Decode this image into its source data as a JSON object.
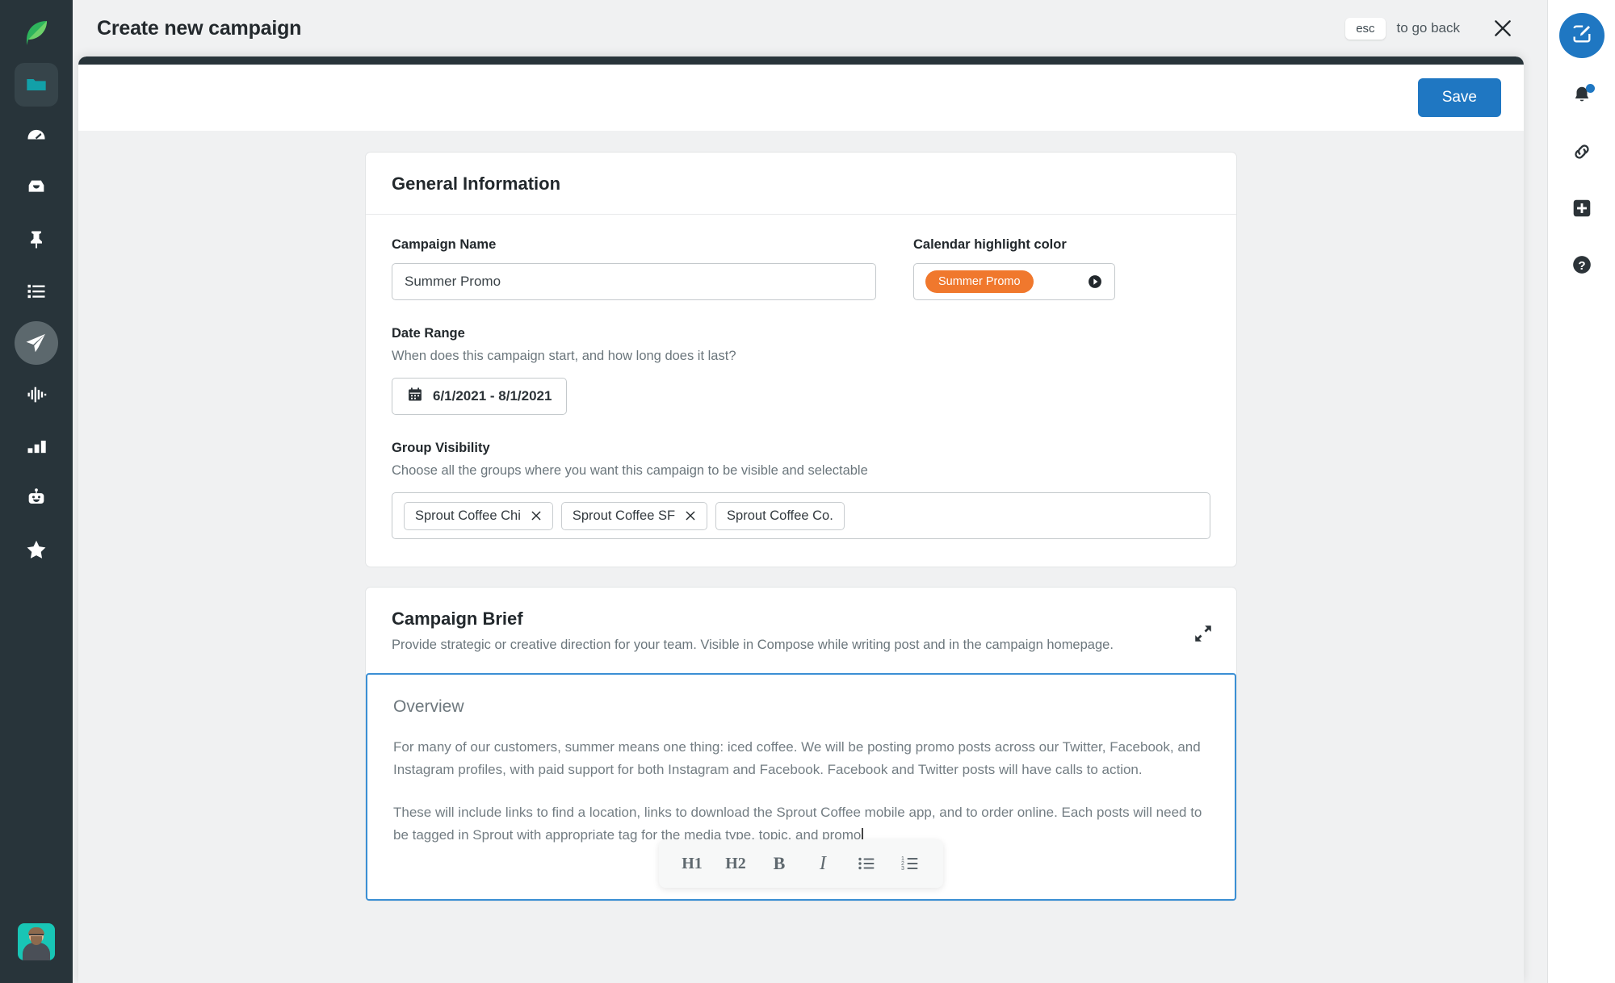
{
  "header": {
    "title": "Create new campaign",
    "esc_key": "esc",
    "esc_hint": "to go back",
    "close_icon": "close-icon"
  },
  "left_nav": {
    "logo_icon": "sprout-leaf-logo",
    "items": [
      {
        "icon": "folder-icon",
        "name": "folder",
        "state": "boxed"
      },
      {
        "icon": "dashboard-speedometer-icon",
        "name": "dashboard",
        "state": ""
      },
      {
        "icon": "inbox-icon",
        "name": "inbox",
        "state": ""
      },
      {
        "icon": "pin-icon",
        "name": "publishing-pin",
        "state": ""
      },
      {
        "icon": "list-icon",
        "name": "tasks-list",
        "state": ""
      },
      {
        "icon": "paper-plane-icon",
        "name": "publishing",
        "state": "active"
      },
      {
        "icon": "pulse-waveform-icon",
        "name": "listening",
        "state": ""
      },
      {
        "icon": "bar-chart-icon",
        "name": "reports",
        "state": ""
      },
      {
        "icon": "bot-icon",
        "name": "bots",
        "state": ""
      },
      {
        "icon": "star-half-icon",
        "name": "reviews",
        "state": ""
      }
    ],
    "avatar_name": "user-avatar"
  },
  "right_rail": {
    "compose_icon": "compose-pencil-icon",
    "items": [
      {
        "icon": "bell-icon",
        "name": "notifications",
        "badge": true
      },
      {
        "icon": "link-icon",
        "name": "link-shortener",
        "badge": false
      },
      {
        "icon": "plus-square-icon",
        "name": "add-new",
        "badge": false
      },
      {
        "icon": "question-circle-icon",
        "name": "help",
        "badge": false
      }
    ]
  },
  "toolbar": {
    "save_label": "Save"
  },
  "general_information": {
    "title": "General Information",
    "campaign_name": {
      "label": "Campaign Name",
      "value": "Summer Promo",
      "placeholder": "Campaign Name"
    },
    "calendar_highlight_color": {
      "label": "Calendar highlight color",
      "selected_label": "Summer Promo",
      "selected_color": "#f0782d",
      "caret_icon": "caret-right-circle-icon"
    },
    "date_range": {
      "label": "Date Range",
      "help": "When does this campaign start, and how long does it last?",
      "value": "6/1/2021 - 8/1/2021",
      "icon": "calendar-icon"
    },
    "group_visibility": {
      "label": "Group Visibility",
      "help": "Choose all the groups where you want this campaign to be visible and selectable",
      "tokens": [
        {
          "label": "Sprout Coffee Chi",
          "removable": true
        },
        {
          "label": "Sprout Coffee SF",
          "removable": true
        },
        {
          "label": "Sprout Coffee Co.",
          "removable": false
        }
      ]
    }
  },
  "campaign_brief": {
    "title": "Campaign Brief",
    "subtitle": "Provide strategic or creative direction for your team. Visible in Compose while writing post and in the campaign homepage.",
    "expand_icon": "expand-diagonal-icon",
    "editor": {
      "heading": "Overview",
      "paragraph_1": "For many of our customers, summer means one thing: iced coffee. We will be posting promo posts across our Twitter, Facebook, and Instagram profiles, with paid support for both Instagram and Facebook. Facebook and Twitter posts will have calls to action.",
      "paragraph_2": "These will include links to find a location, links to download the Sprout Coffee mobile app, and to order online. Each posts will need to be tagged in Sprout with appropriate tag for the media type, topic, and promo"
    },
    "format_toolbar": [
      {
        "label": "H1",
        "name": "heading-1-button"
      },
      {
        "label": "H2",
        "name": "heading-2-button"
      },
      {
        "label": "B",
        "name": "bold-button"
      },
      {
        "label": "I",
        "name": "italic-button"
      },
      {
        "label": "",
        "name": "bulleted-list-button"
      },
      {
        "label": "",
        "name": "numbered-list-button"
      }
    ]
  },
  "colors": {
    "accent_blue": "#1f77c2",
    "nav_dark": "#28343a",
    "campaign_orange": "#f0782d",
    "editor_focus_border": "#3b8fd4"
  }
}
